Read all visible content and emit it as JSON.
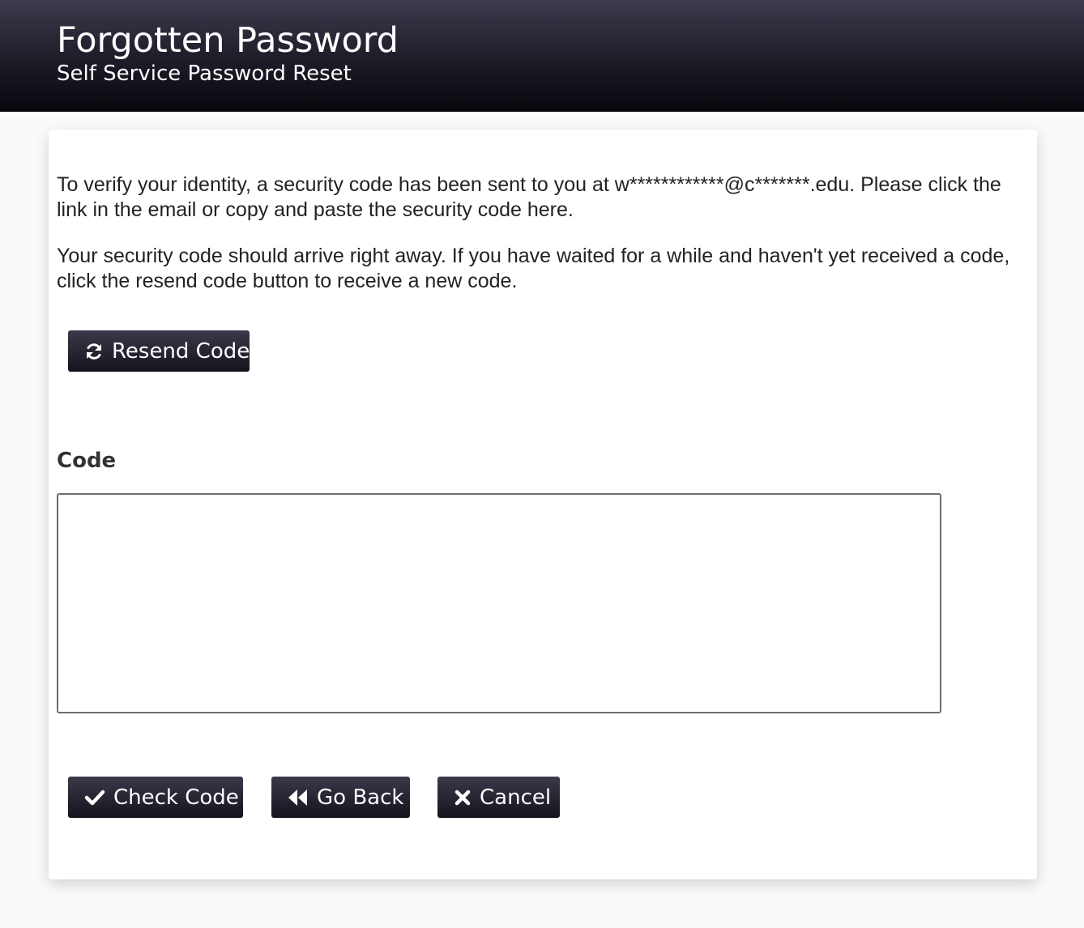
{
  "header": {
    "title": "Forgotten Password",
    "subtitle": "Self Service Password Reset"
  },
  "message": {
    "paragraph_1": "To verify your identity, a security code has been sent to you at w************@c*******.edu. Please click the link in the email or copy and paste the security code here.",
    "paragraph_2": "Your security code should arrive right away. If you have waited for a while and haven't yet received a code, click the resend code button to receive a new code."
  },
  "resend_button": {
    "label": "Resend Code",
    "icon": "refresh-icon"
  },
  "code_field": {
    "label": "Code",
    "value": ""
  },
  "actions": {
    "check_code": {
      "label": "Check Code",
      "icon": "checkmark-icon"
    },
    "go_back": {
      "label": "Go Back",
      "icon": "double-back-arrow-icon"
    },
    "cancel": {
      "label": "Cancel",
      "icon": "close-icon"
    }
  },
  "colors": {
    "header_gradient_top": "#3d3b4d",
    "header_gradient_bottom": "#08070d",
    "button_gradient_top": "#3b394a",
    "button_gradient_bottom": "#14131c",
    "page_background": "#fafafa",
    "panel_background": "#ffffff"
  }
}
